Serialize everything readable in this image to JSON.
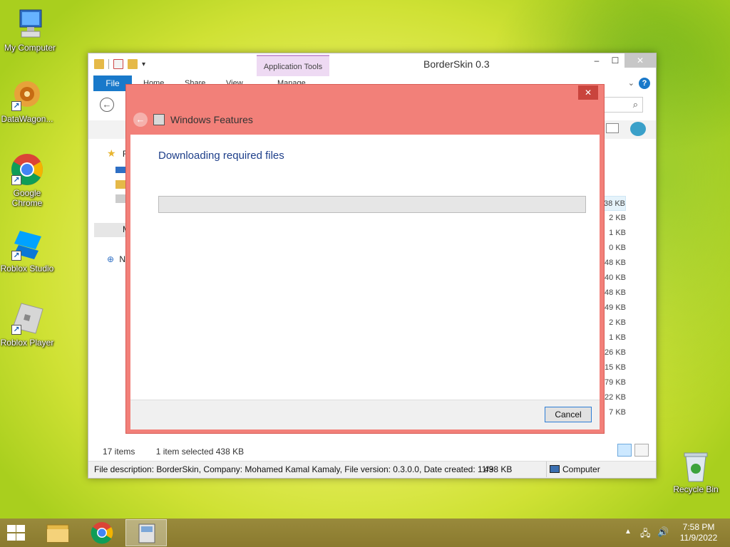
{
  "desktop": {
    "icons": [
      {
        "label": "My Computer"
      },
      {
        "label": "DataWagon..."
      },
      {
        "label": "Google Chrome"
      },
      {
        "label": "Roblox Studio"
      },
      {
        "label": "Roblox Player"
      },
      {
        "label": "Recycle Bin"
      }
    ]
  },
  "explorer": {
    "title": "BorderSkin 0.3",
    "app_tools_tab": "Application Tools",
    "tabs": {
      "file": "File",
      "home": "Home",
      "share": "Share",
      "view": "View",
      "manage": "Manage"
    },
    "nav_items": [
      "F",
      "M",
      "N"
    ],
    "file_sizes": [
      "38 KB",
      "2 KB",
      "1 KB",
      "0 KB",
      "48 KB",
      "40 KB",
      "48 KB",
      "49 KB",
      "2 KB",
      "1 KB",
      "26 KB",
      "15 KB",
      "79 KB",
      "22 KB",
      "7 KB"
    ],
    "status": {
      "item_count": "17 items",
      "selection": "1 item selected  438 KB"
    },
    "description": "File description: BorderSkin, Company: Mohamed Kamal Kamaly, File version: 0.3.0.0, Date created: 11/9",
    "description_size": "438 KB",
    "location": "Computer",
    "window_buttons": {
      "minimize": "–",
      "maximize": "☐",
      "close": "✕"
    },
    "help": "?"
  },
  "dialog": {
    "title": "Windows Features",
    "heading": "Downloading required files",
    "progress": 0,
    "cancel_label": "Cancel",
    "close": "✕"
  },
  "taskbar": {
    "time": "7:58 PM",
    "date": "11/9/2022"
  },
  "colors": {
    "dialog_border": "#f28079",
    "file_tab": "#1979ca",
    "heading": "#1e3f8a"
  }
}
